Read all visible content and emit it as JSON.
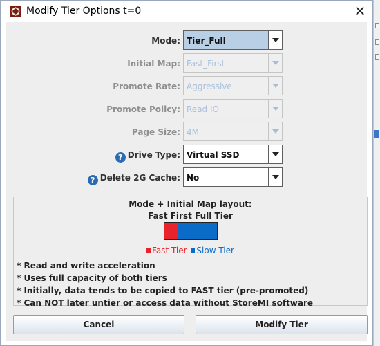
{
  "window": {
    "title": "Modify Tier Options t=0",
    "close_symbol": "✕"
  },
  "form": {
    "mode": {
      "label": "Mode:",
      "value": "Tier_Full",
      "enabled": true
    },
    "initial_map": {
      "label": "Initial Map:",
      "value": "Fast_First",
      "enabled": false
    },
    "promote_rate": {
      "label": "Promote Rate:",
      "value": "Aggressive",
      "enabled": false
    },
    "promote_policy": {
      "label": "Promote Policy:",
      "value": "Read IO",
      "enabled": false
    },
    "page_size": {
      "label": "Page Size:",
      "value": "4M",
      "enabled": false
    },
    "drive_type": {
      "label": "Drive Type:",
      "value": "Virtual SSD",
      "enabled": true,
      "help": "?"
    },
    "delete_2g_cache": {
      "label": "Delete 2G Cache:",
      "value": "No",
      "enabled": true,
      "help": "?"
    }
  },
  "layout_panel": {
    "title": "Mode + Initial Map layout:",
    "subtitle": "Fast First Full Tier",
    "fast_fraction": 0.26,
    "legend": {
      "fast": "Fast Tier",
      "slow": "Slow Tier"
    },
    "colors": {
      "fast": "#e8232b",
      "slow": "#0b6cc8"
    },
    "notes": [
      "* Read and write acceleration",
      "* Uses full capacity of both tiers",
      "* Initially, data tends to be copied to FAST tier (pre-promoted)",
      "* Can NOT later untier or access data without StoreMI software"
    ]
  },
  "buttons": {
    "cancel": "Cancel",
    "modify": "Modify Tier"
  }
}
